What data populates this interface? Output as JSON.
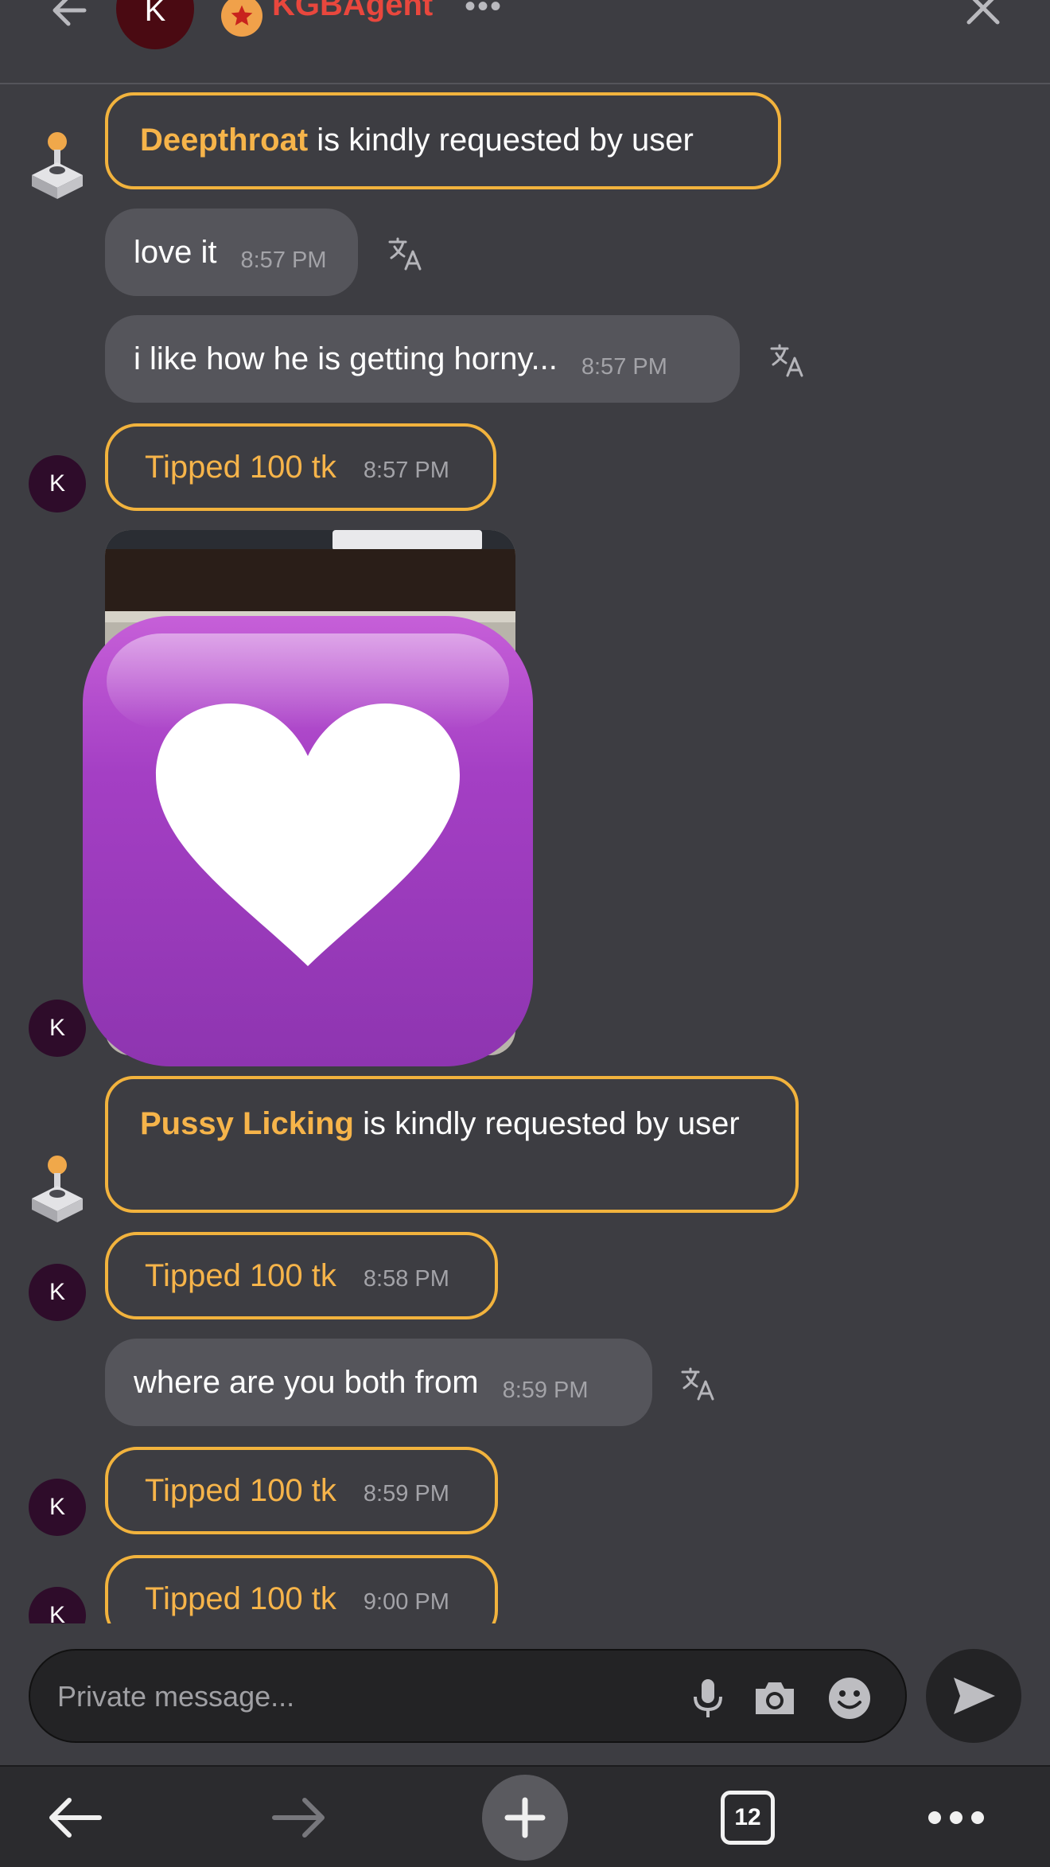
{
  "header": {
    "back_icon": "arrow-left-icon",
    "avatar_initial": "K",
    "username": "KGBAgent",
    "more_label": "•••",
    "close_icon": "close-icon",
    "name_color": "#e9473d",
    "badge_color": "#f0a14a"
  },
  "messages": [
    {
      "type": "request",
      "highlight": "Deepthroat",
      "text": " is kindly requested by user"
    },
    {
      "type": "text",
      "text": "love it",
      "time": "8:57 PM"
    },
    {
      "type": "text",
      "text": "i like how he is getting horny...",
      "time": "8:57 PM"
    },
    {
      "type": "tip",
      "text": "Tipped 100 tk",
      "time": "8:57 PM",
      "avatar": "K"
    },
    {
      "type": "image",
      "avatar": "K",
      "overlay": "purple-heart-emoji"
    },
    {
      "type": "request",
      "highlight": "Pussy Licking",
      "text": " is kindly requested by user"
    },
    {
      "type": "tip",
      "text": "Tipped 100 tk",
      "time": "8:58 PM",
      "avatar": "K"
    },
    {
      "type": "text",
      "text": "where are you both from",
      "time": "8:59 PM"
    },
    {
      "type": "tip",
      "text": "Tipped 100 tk",
      "time": "8:59 PM",
      "avatar": "K"
    },
    {
      "type": "tip",
      "text": "Tipped 100 tk",
      "time": "9:00 PM",
      "avatar": "K"
    }
  ],
  "composer": {
    "placeholder": "Private message...",
    "icons": [
      "microphone-icon",
      "camera-icon",
      "emoji-icon"
    ],
    "send_icon": "send-icon"
  },
  "browser_bar": {
    "tab_count": "12",
    "icons": [
      "back-arrow-icon",
      "forward-arrow-icon",
      "new-tab-plus-icon",
      "tabs-icon",
      "more-icon"
    ]
  },
  "colors": {
    "background": "#3d3d42",
    "accent": "#f2b33d",
    "bubble": "#55555b",
    "avatar": "#2e0c2a"
  }
}
